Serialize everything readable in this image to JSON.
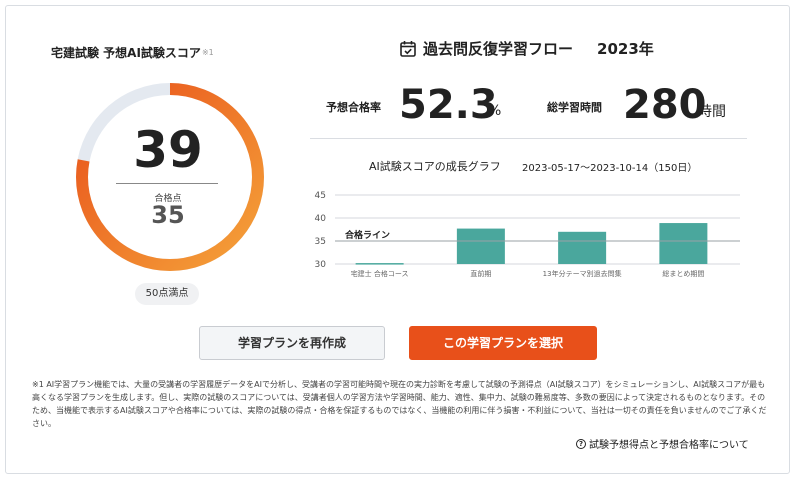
{
  "score_panel": {
    "title": "宅建試験 予想AI試験スコア",
    "title_note": "※1",
    "score": "39",
    "score_value": 39,
    "max_score": 50,
    "pass_label": "合格点",
    "pass_value": "35",
    "full_marks": "50点満点",
    "colors": {
      "ring_start": "#f5a33a",
      "ring_end": "#e8501a",
      "ring_track": "#e4e9f0"
    }
  },
  "flow": {
    "title": "過去問反復学習フロー",
    "year": "2023年",
    "icon": "calendar-check-icon"
  },
  "stats": {
    "pass_rate_label": "予想合格率",
    "pass_rate_value": "52.3",
    "pass_rate_unit": "%",
    "study_time_label": "総学習時間",
    "study_time_value": "280",
    "study_time_unit": "時間"
  },
  "chart": {
    "title": "AI試験スコアの成長グラフ",
    "range": "2023-05-17～2023-10-14（150日）"
  },
  "chart_data": {
    "type": "bar",
    "categories": [
      "宅建士 合格コース",
      "直前期",
      "13年分テーマ別過去問集",
      "総まとめ期間"
    ],
    "values": [
      30.2,
      37.7,
      37.0,
      38.9
    ],
    "ylim": [
      30,
      45
    ],
    "yticks": [
      30,
      35,
      40,
      45
    ],
    "reference_line": {
      "label": "合格ライン",
      "value": 35
    },
    "colors": {
      "bar": "#4aa79d",
      "grid": "#d4d7dc",
      "reference": "#9aa0a6"
    }
  },
  "buttons": {
    "recreate": "学習プランを再作成",
    "select": "この学習プランを選択"
  },
  "disclaimer": "※1 AI学習プラン機能では、大量の受講者の学習履歴データをAIで分析し、受講者の学習可能時間や現在の実力診断を考慮して試験の予測得点（AI試験スコア）をシミュレーションし、AI試験スコアが最も高くなる学習プランを生成します。但し、実際の試験のスコアについては、受講者個人の学習方法や学習時間、能力、適性、集中力、試験の難易度等、多数の要因によって決定されるものとなります。そのため、当機能で表示するAI試験スコアや合格率については、実際の試験の得点・合格を保証するものではなく、当機能の利用に伴う損害・不利益について、当社は一切その責任を負いませんのでご了承ください。",
  "info_link": "試験予想得点と予想合格率について"
}
